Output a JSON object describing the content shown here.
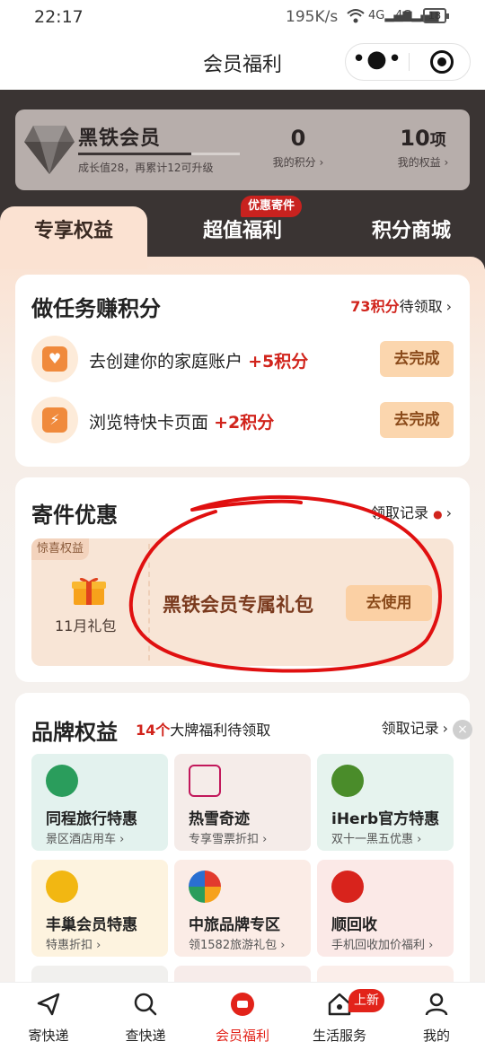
{
  "status_bar": {
    "time": "22:17",
    "speed": "195K/s",
    "net1": "4G",
    "net2": "4G",
    "battery": "18"
  },
  "header": {
    "title": "会员福利",
    "more_glyph": "•●•"
  },
  "member": {
    "level_name": "黑铁会员",
    "growth_text": "成长值28，再累计12可升级",
    "growth_progress": 0.7,
    "points_value": "0",
    "points_label": "我的积分",
    "benefits_value": "10",
    "benefits_unit": "项",
    "benefits_label": "我的权益",
    "chevron": "›"
  },
  "tabs": [
    {
      "label": "专享权益",
      "active": true
    },
    {
      "label": "超值福利",
      "tag": "优惠寄件"
    },
    {
      "label": "积分商城"
    }
  ],
  "tasks_section": {
    "title": "做任务赚积分",
    "pending_points": "73积分",
    "pending_suffix": "待领取",
    "chevron": "›",
    "items": [
      {
        "icon": "house-heart-icon",
        "text": "去创建你的家庭账户",
        "points": "+5积分",
        "button": "去完成"
      },
      {
        "icon": "lightning-card-icon",
        "text": "浏览特快卡页面",
        "points": "+2积分",
        "button": "去完成"
      }
    ]
  },
  "shipping_section": {
    "title": "寄件优惠",
    "record_link": "领取记录",
    "chevron": "›",
    "coupon": {
      "badge": "惊喜权益",
      "gift_label": "11月礼包",
      "title": "黑铁会员专属礼包",
      "button": "去使用"
    }
  },
  "brand_section": {
    "title": "品牌权益",
    "count": "14个",
    "count_suffix": "大牌福利待领取",
    "record_link": "领取记录",
    "chevron": "›",
    "close": "×",
    "items": [
      {
        "name": "同程旅行特惠",
        "desc": "景区酒店用车 ›",
        "icon_color": "#2a9d5c",
        "bg": "#e3f2ee"
      },
      {
        "name": "热雪奇迹",
        "desc": "专享雪票折扣 ›",
        "icon_color": "#c2185b",
        "bg": "#f5ece9"
      },
      {
        "name": "iHerb官方特惠",
        "desc": "双十一黑五优惠 ›",
        "icon_color": "#4a8c2a",
        "bg": "#e6f3ee"
      },
      {
        "name": "丰巢会员特惠",
        "desc": "特惠折扣 ›",
        "icon_color": "#f2b712",
        "bg": "#fdf3df"
      },
      {
        "name": "中旅品牌专区",
        "desc": "领1582旅游礼包 ›",
        "icon_color": "#e23b2e",
        "bg": "#fbece6"
      },
      {
        "name": "顺回收",
        "desc": "手机回收加价福利 ›",
        "icon_color": "#d8231c",
        "bg": "#fbe9e7"
      }
    ]
  },
  "bottom_nav": [
    {
      "label": "寄快递",
      "icon": "send-icon"
    },
    {
      "label": "查快递",
      "icon": "search-icon"
    },
    {
      "label": "会员福利",
      "icon": "member-icon",
      "active": true
    },
    {
      "label": "生活服务",
      "icon": "house-icon",
      "badge": "上新"
    },
    {
      "label": "我的",
      "icon": "person-icon"
    }
  ],
  "colors": {
    "accent_red": "#d1241c",
    "dark_header": "#3a3433",
    "tab_active": "#fbe2d2"
  }
}
